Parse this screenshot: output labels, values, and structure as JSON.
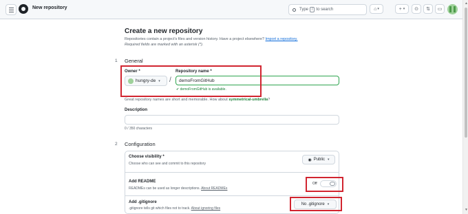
{
  "header": {
    "title": "New repository",
    "search": {
      "placeholder_before": "Type",
      "shortcut": "/",
      "placeholder_after": "to search"
    },
    "buttons": {
      "copilot_glyph": "⌂",
      "create_glyph": "+",
      "create_caret": "▾",
      "issues_glyph": "⊙",
      "pulls_glyph": "⇅",
      "inbox_glyph": "▭"
    }
  },
  "page": {
    "title": "Create a new repository",
    "subtitle": "Repositories contain a project's files and version history. Have a project elsewhere?",
    "import_link": "Import a repository.",
    "required_note": "Required fields are marked with an asterisk (*)."
  },
  "general": {
    "step": "1",
    "title": "General",
    "owner_label": "Owner *",
    "owner_value": "hungry-de",
    "repo_label": "Repository name *",
    "repo_value": "demoFromGitHub",
    "availability": "demoFromGitHub is available.",
    "hint_before": "Great repository names are short and memorable. How about",
    "hint_suggestion": "symmetrical-umbrella",
    "hint_after": "?",
    "description_label": "Description",
    "description_counter": "0 / 350 characters"
  },
  "configuration": {
    "step": "2",
    "title": "Configuration",
    "visibility_label": "Choose visibility *",
    "visibility_help": "Choose who can see and commit to this repository",
    "visibility_value": "Public",
    "readme_label": "Add README",
    "readme_help_before": "READMEs can be used as longer descriptions.",
    "readme_link": "About READMEs",
    "readme_toggle_state": "Off",
    "gitignore_label": "Add .gitignore",
    "gitignore_help_before": ".gitignore tells git which files not to track.",
    "gitignore_link": "About ignoring files",
    "gitignore_value": "No .gitignore"
  },
  "colors": {
    "accent_link": "#0969da",
    "success": "#1a7f37",
    "highlight_box": "#d1242f"
  }
}
